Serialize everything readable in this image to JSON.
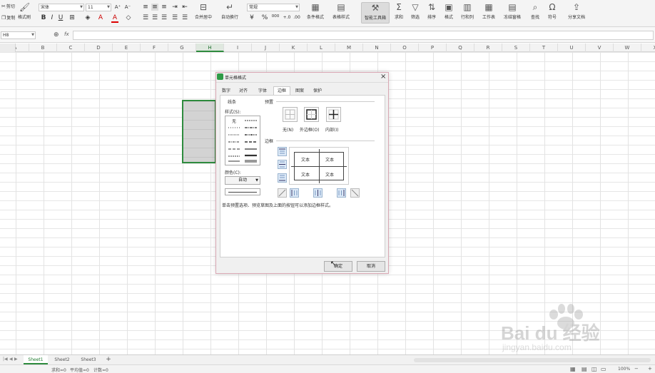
{
  "ribbon": {
    "cut": "剪切",
    "copy": "复制",
    "painter": "格式刷",
    "font_name": "宋体",
    "font_size": "11",
    "merge": "合并居中",
    "wrap": "自动换行",
    "numfmt": "常规",
    "cond_fmt": "条件格式",
    "table_style": "表格样式",
    "smart_tool": "智能工具箱",
    "sum": "求和",
    "filter": "筛选",
    "sort": "排序",
    "format": "格式",
    "rowcol": "行和列",
    "sheet": "工作表",
    "freeze": "冻结窗格",
    "find": "查找",
    "symbol": "符号",
    "share": "分享文档"
  },
  "formula_bar": {
    "cell_ref": "H8",
    "fx": "fx"
  },
  "columns": [
    "A",
    "B",
    "C",
    "D",
    "E",
    "F",
    "G",
    "H",
    "I",
    "J",
    "K",
    "L",
    "M",
    "N",
    "O",
    "P",
    "Q",
    "R",
    "S",
    "T",
    "U",
    "V",
    "W",
    "X"
  ],
  "sheets": [
    "Sheet1",
    "Sheet2",
    "Sheet3"
  ],
  "add_sheet": "+",
  "status": {
    "sum": "求和=0",
    "avg": "平均值=0",
    "count": "计数=0",
    "zoom": "100%"
  },
  "dialog": {
    "title": "单元格格式",
    "close": "×",
    "tabs": [
      "数字",
      "对齐",
      "字体",
      "边框",
      "图案",
      "保护"
    ],
    "active_tab": "边框",
    "line_group": "线条",
    "style_label": "样式(S):",
    "none_label": "无",
    "color_label": "颜色(C):",
    "color_value": "自动",
    "preset_group": "预置",
    "preset_none": "无(N)",
    "preset_outline": "外边框(O)",
    "preset_inside": "内部(I)",
    "border_group": "边框",
    "preview_text": [
      "文本",
      "文本",
      "文本",
      "文本"
    ],
    "hint": "单击预置选项、预览草图及上面的按钮可以添加边框样式。",
    "ok": "确定",
    "cancel": "取消"
  },
  "watermark": {
    "logo": "Bai du 经验",
    "url": "jingyan.baidu.com"
  }
}
